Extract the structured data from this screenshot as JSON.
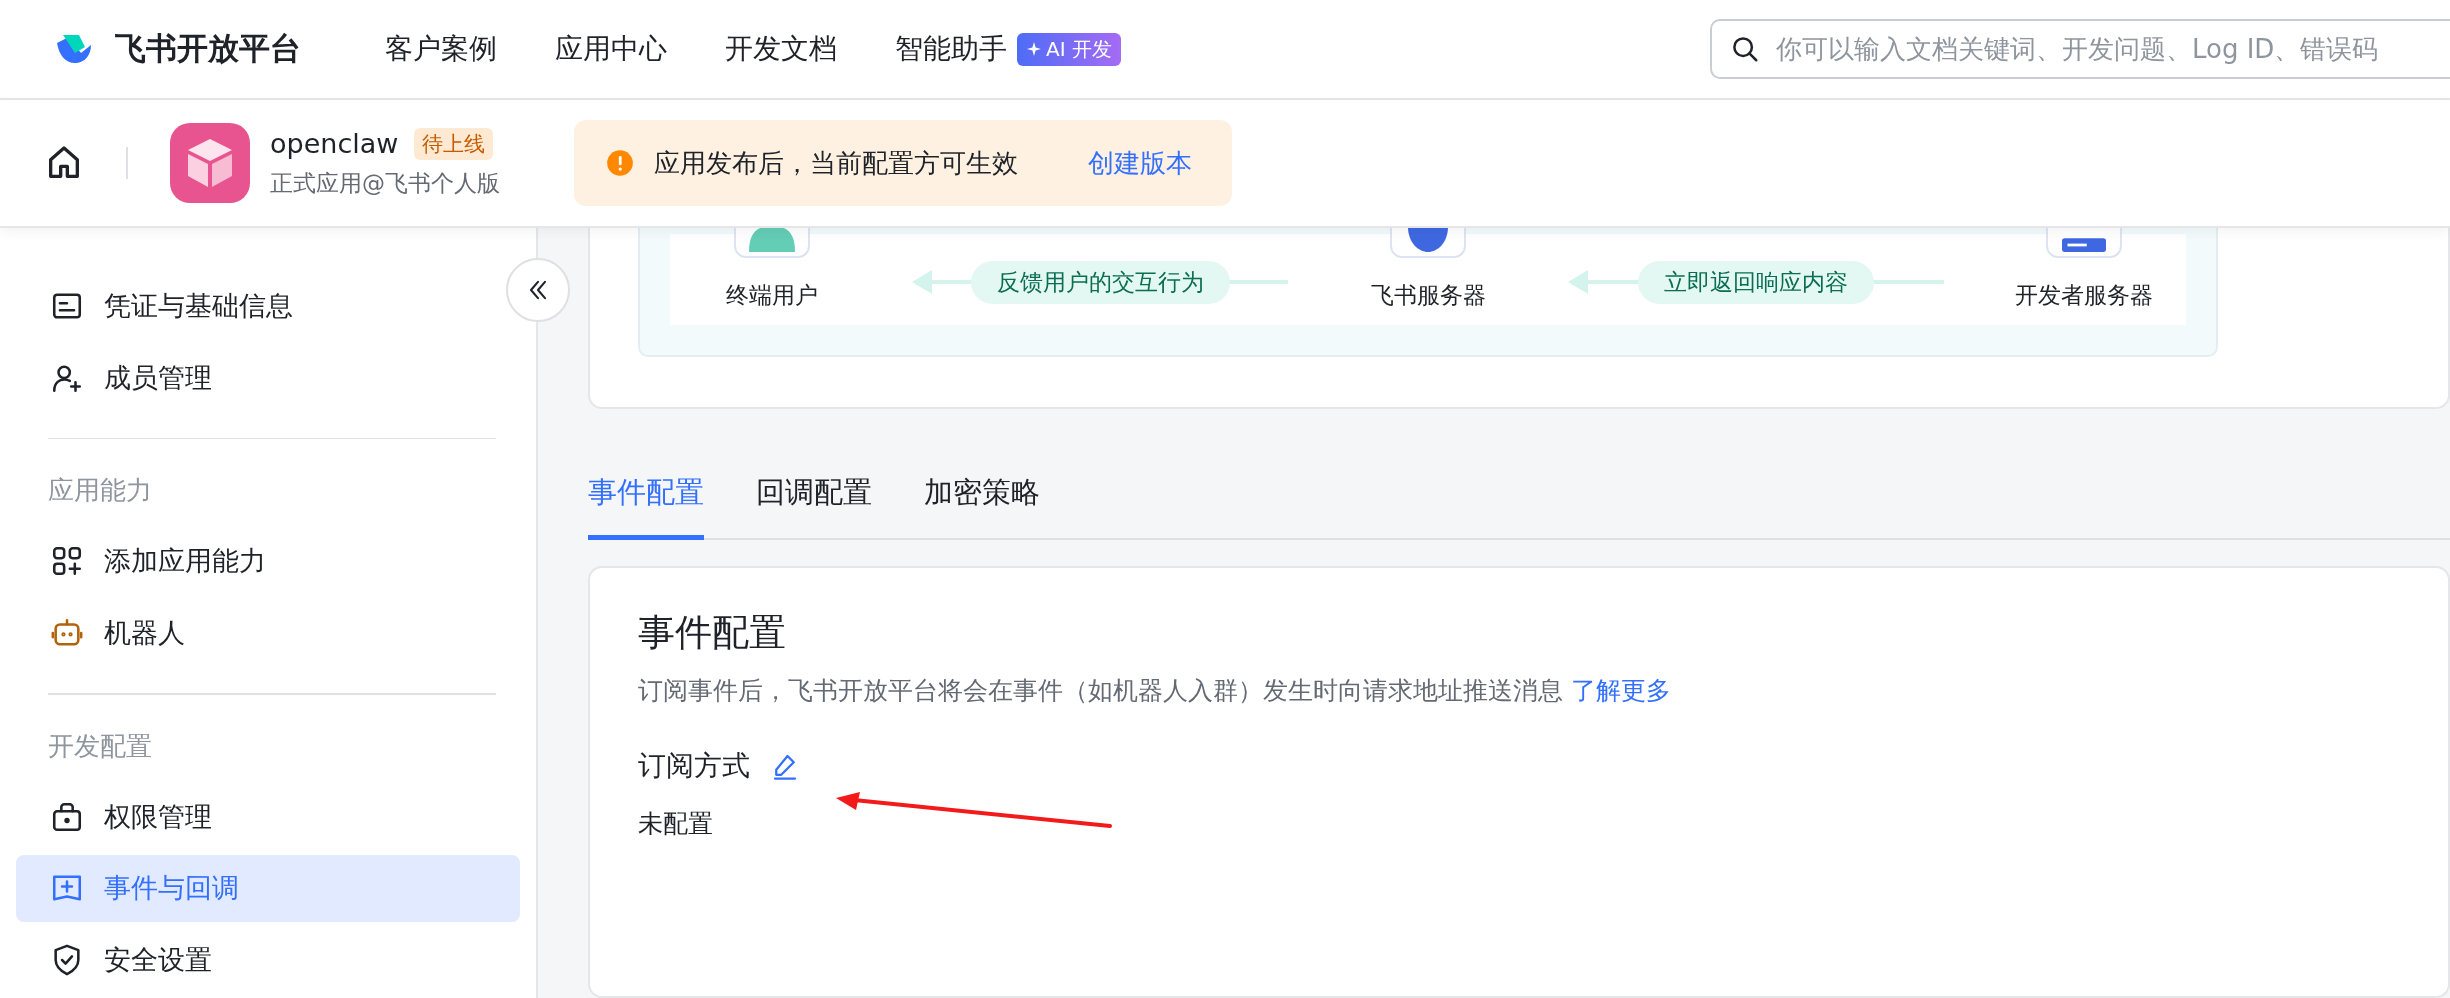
{
  "nav": {
    "logo_text": "飞书开放平台",
    "items": [
      {
        "label": "客户案例"
      },
      {
        "label": "应用中心"
      },
      {
        "label": "开发文档"
      },
      {
        "label": "智能助手",
        "badge": "AI 开发"
      }
    ],
    "search": {
      "placeholder": "你可以输入文档关键词、开发问题、Log ID、错误码"
    }
  },
  "app_header": {
    "name": "openclaw",
    "status": "待上线",
    "subtitle": "正式应用@飞书个人版",
    "notice": {
      "text": "应用发布后，当前配置方可生效",
      "link": "创建版本"
    }
  },
  "sidebar": {
    "sections": [
      {
        "items": [
          {
            "label": "凭证与基础信息",
            "selected": false
          },
          {
            "label": "成员管理",
            "selected": false
          }
        ]
      },
      {
        "title": "应用能力",
        "items": [
          {
            "label": "添加应用能力",
            "selected": false
          },
          {
            "label": "机器人",
            "selected": false
          }
        ]
      },
      {
        "title": "开发配置",
        "items": [
          {
            "label": "权限管理",
            "selected": false
          },
          {
            "label": "事件与回调",
            "selected": true
          },
          {
            "label": "安全设置",
            "selected": false
          }
        ]
      }
    ]
  },
  "diagram": {
    "nodes": [
      {
        "label": "终端用户"
      },
      {
        "label": "飞书服务器"
      },
      {
        "label": "开发者服务器"
      }
    ],
    "arrows": [
      {
        "label": "反馈用户的交互行为"
      },
      {
        "label": "立即返回响应内容"
      }
    ]
  },
  "tabs": [
    {
      "label": "事件配置",
      "selected": true
    },
    {
      "label": "回调配置",
      "selected": false
    },
    {
      "label": "加密策略",
      "selected": false
    }
  ],
  "panel": {
    "title": "事件配置",
    "description": "订阅事件后，飞书开放平台将会在事件（如机器人入群）发生时向请求地址推送消息",
    "link": "了解更多",
    "subscription": {
      "label": "订阅方式",
      "value": "未配置"
    }
  }
}
